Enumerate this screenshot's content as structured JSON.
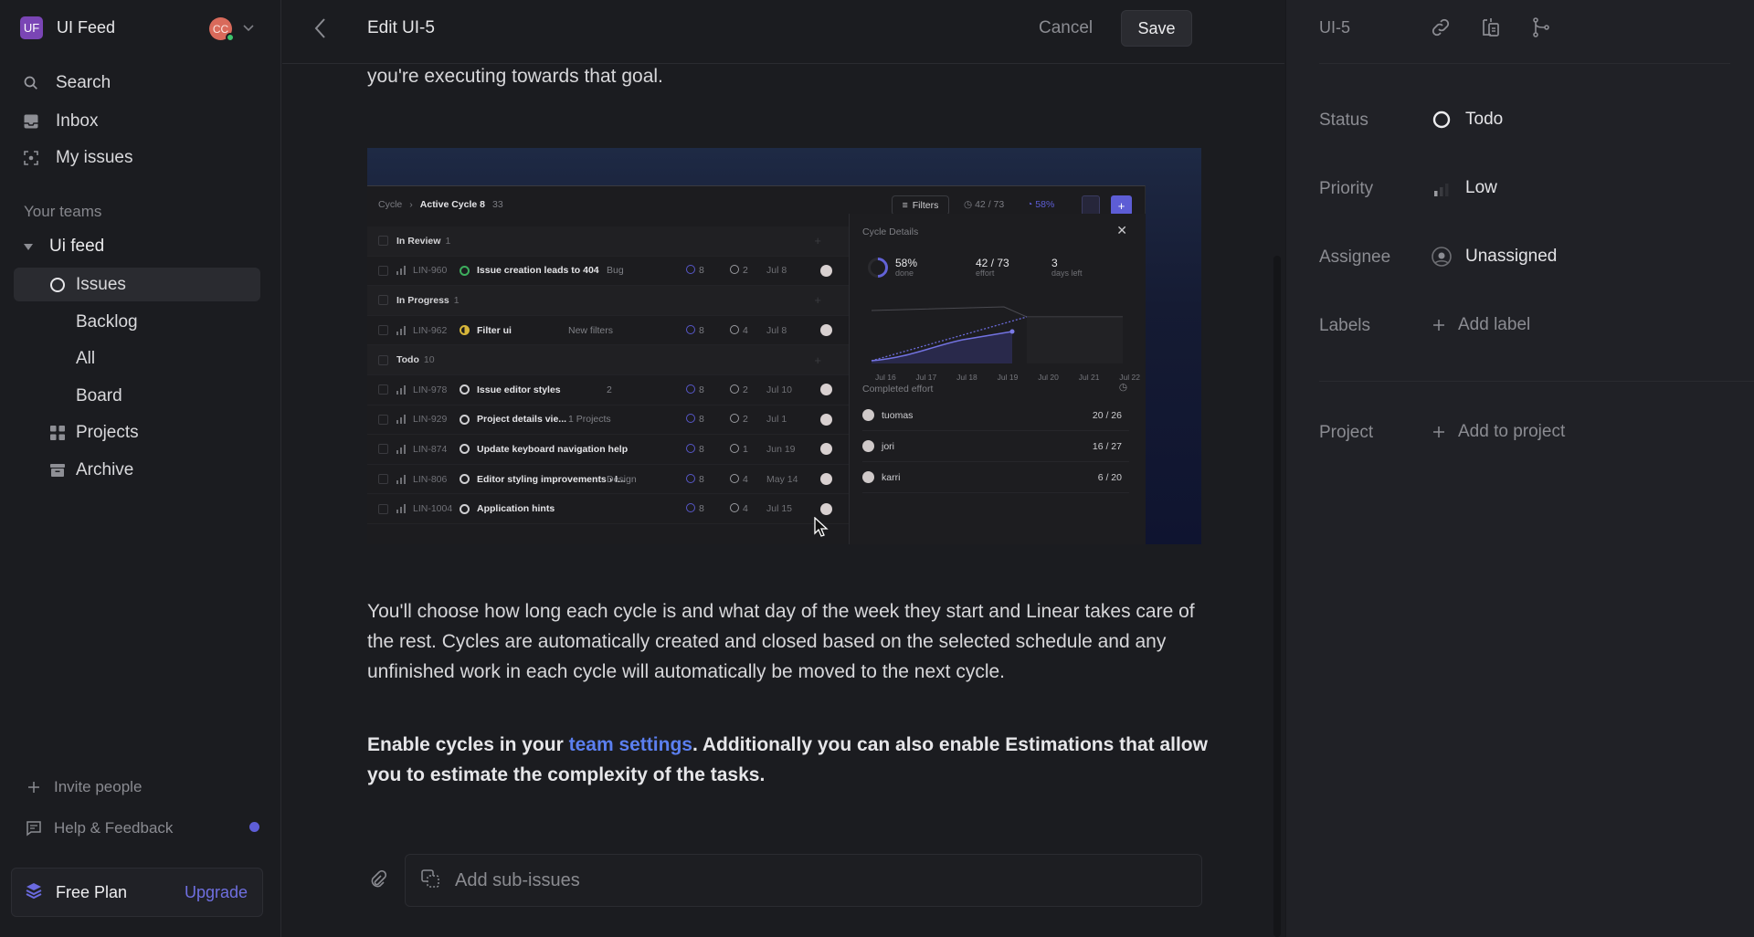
{
  "sidebar": {
    "workspace": {
      "initials": "UF",
      "name": "UI Feed"
    },
    "user": {
      "initials": "CC",
      "status": "online"
    },
    "nav": [
      {
        "label": "Search",
        "icon": "search-icon"
      },
      {
        "label": "Inbox",
        "icon": "inbox-icon"
      },
      {
        "label": "My issues",
        "icon": "my-issues-icon"
      }
    ],
    "section_label": "Your teams",
    "team": {
      "name": "Ui feed",
      "items": [
        {
          "label": "Issues",
          "icon": "circle-icon",
          "active": true
        },
        {
          "label": "Backlog"
        },
        {
          "label": "All"
        },
        {
          "label": "Board"
        },
        {
          "label": "Projects",
          "icon": "grid-icon"
        },
        {
          "label": "Archive",
          "icon": "archive-icon"
        }
      ]
    },
    "invite_label": "Invite people",
    "help_label": "Help & Feedback",
    "plan": {
      "name": "Free Plan",
      "upgrade_label": "Upgrade"
    }
  },
  "main": {
    "title": "Edit UI-5",
    "cancel_label": "Cancel",
    "save_label": "Save",
    "intro_tail": "you're executing towards that goal.",
    "paragraph_2": "You'll choose how long each cycle is and what day of the week they start and Linear takes care of the rest. Cycles are automatically created and closed based on the selected schedule and any unfinished work in each cycle will automatically be moved to the next cycle.",
    "paragraph_3": {
      "before": "Enable cycles in your ",
      "link": "team settings",
      "after": ". Additionally you can also enable Estimations that allow you to estimate the complexity of the tasks."
    },
    "subissues_placeholder": "Add sub-issues",
    "embedded_image": {
      "breadcrumb": {
        "parent": "Cycle",
        "current": "Active Cycle 8",
        "count": "33"
      },
      "toolbar": {
        "filters": "Filters",
        "effort": "42 / 73",
        "progress": "58%"
      },
      "groups": [
        {
          "name": "In Review",
          "count": "1",
          "issues": [
            {
              "id": "LIN-960",
              "title": "Issue creation leads to 404",
              "status": "review",
              "tag": "Bug",
              "estimate": "8",
              "time": "2",
              "date": "Jul 8"
            }
          ]
        },
        {
          "name": "In Progress",
          "count": "1",
          "issues": [
            {
              "id": "LIN-962",
              "title": "Filter ui",
              "status": "progress",
              "tag": "New filters",
              "estimate": "8",
              "time": "4",
              "date": "Jul 8"
            }
          ]
        },
        {
          "name": "Todo",
          "count": "10",
          "issues": [
            {
              "id": "LIN-978",
              "title": "Issue editor styles",
              "status": "todo",
              "tag": "2",
              "estimate": "8",
              "time": "2",
              "date": "Jul 10"
            },
            {
              "id": "LIN-929",
              "title": "Project details vie...",
              "status": "todo",
              "tag": "1   Projects",
              "estimate": "8",
              "time": "2",
              "date": "Jul 1"
            },
            {
              "id": "LIN-874",
              "title": "Update keyboard navigation help",
              "status": "todo",
              "tag": "",
              "estimate": "8",
              "time": "1",
              "date": "Jun 19"
            },
            {
              "id": "LIN-806",
              "title": "Editor styling improvements › I...",
              "status": "todo",
              "tag": "Design",
              "estimate": "8",
              "time": "4",
              "date": "May 14"
            },
            {
              "id": "LIN-1004",
              "title": "Application hints",
              "status": "todo",
              "tag": "",
              "estimate": "8",
              "time": "4",
              "date": "Jul 15"
            }
          ]
        }
      ],
      "cycle_details": {
        "title": "Cycle Details",
        "stats": [
          {
            "value": "58%",
            "label": "done"
          },
          {
            "value": "42 / 73",
            "label": "effort"
          },
          {
            "value": "3",
            "label": "days left"
          }
        ],
        "x_ticks": [
          "Jul 16",
          "Jul 17",
          "Jul 18",
          "Jul 19",
          "Jul 20",
          "Jul 21",
          "Jul 22"
        ],
        "completed_effort_title": "Completed effort",
        "people": [
          {
            "name": "tuomas",
            "value": "20 / 26"
          },
          {
            "name": "jori",
            "value": "16 / 27"
          },
          {
            "name": "karri",
            "value": "6 / 20"
          }
        ]
      }
    }
  },
  "details": {
    "issue_id": "UI-5",
    "actions": [
      "link-icon",
      "copy-branch-icon",
      "git-branch-icon"
    ],
    "fields": [
      {
        "label": "Status",
        "value": "Todo",
        "icon": "todo-circle-icon"
      },
      {
        "label": "Priority",
        "value": "Low",
        "icon": "priority-low-icon"
      },
      {
        "label": "Assignee",
        "value": "Unassigned",
        "icon": "unassigned-avatar-icon"
      },
      {
        "label": "Labels",
        "value": "Add label",
        "icon": "plus-icon"
      },
      {
        "label": "Project",
        "value": "Add to project",
        "icon": "plus-icon"
      }
    ]
  },
  "colors": {
    "accent": "#5e5ed8",
    "link": "#5b7ff0",
    "workspace": "#7a45b5",
    "avatar": "#d96a5b"
  }
}
